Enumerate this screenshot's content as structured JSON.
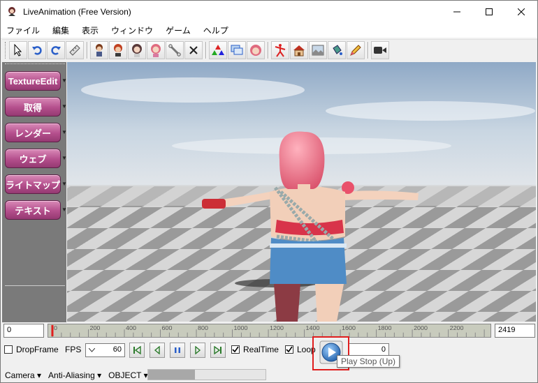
{
  "window": {
    "title": "LiveAnimation (Free Version)"
  },
  "menu": [
    "ファイル",
    "編集",
    "表示",
    "ウィンドウ",
    "ゲーム",
    "ヘルプ"
  ],
  "left_panel": {
    "buttons": [
      "TextureEdit",
      "取得",
      "レンダー",
      "ウェブ",
      "ライトマップ",
      "テキスト"
    ]
  },
  "timeline": {
    "current_frame": "0",
    "end_frame": "2419",
    "ticks": [
      "0",
      "200",
      "400",
      "600",
      "800",
      "1000",
      "1200",
      "1400",
      "1600",
      "1800",
      "2000",
      "2200"
    ],
    "max_frame": 2419
  },
  "controls": {
    "dropframe_label": "DropFrame",
    "fps_label": "FPS",
    "fps_value": "60",
    "realtime_label": "RealTime",
    "realtime_checked": true,
    "loop_label": "Loop",
    "loop_checked": true,
    "counter_value": "0",
    "tooltip": "Play Stop (Up)"
  },
  "statusbar": {
    "items": [
      "Camera",
      "Anti-Aliasing",
      "OBJECT"
    ],
    "progress": 0.4
  },
  "colors": {
    "accent_pink": "#b44f8c",
    "highlight_red": "#e01e1e",
    "timeline_bg": "#c8cbbd"
  }
}
